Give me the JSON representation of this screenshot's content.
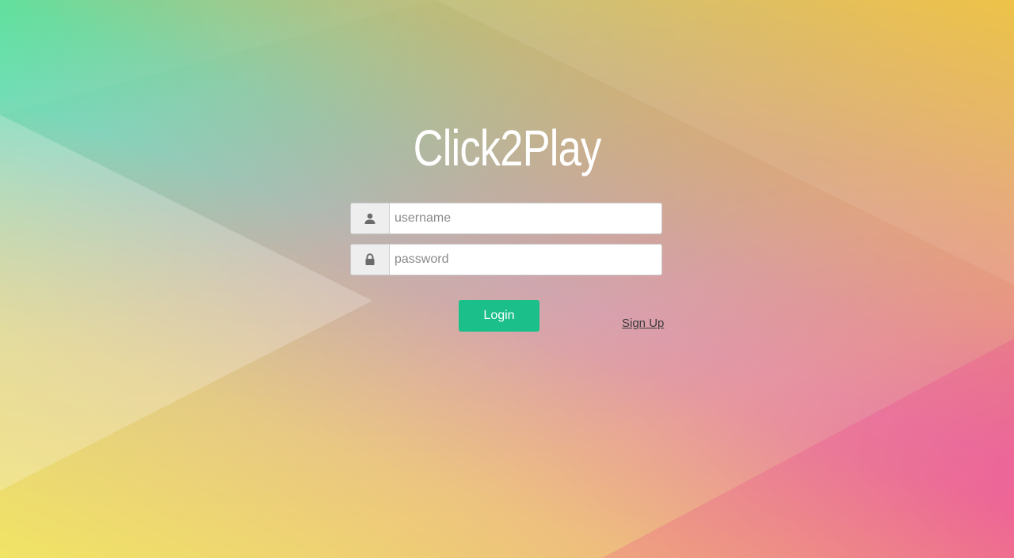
{
  "app": {
    "title": "Click2Play"
  },
  "form": {
    "username": {
      "placeholder": "username",
      "value": "",
      "icon": "user-icon"
    },
    "password": {
      "placeholder": "password",
      "value": "",
      "icon": "lock-icon"
    },
    "login_label": "Login",
    "signup_label": "Sign Up"
  },
  "colors": {
    "login_button": "#1abf8a",
    "title_text": "#ffffff",
    "signup_link": "#3a3a3a"
  }
}
